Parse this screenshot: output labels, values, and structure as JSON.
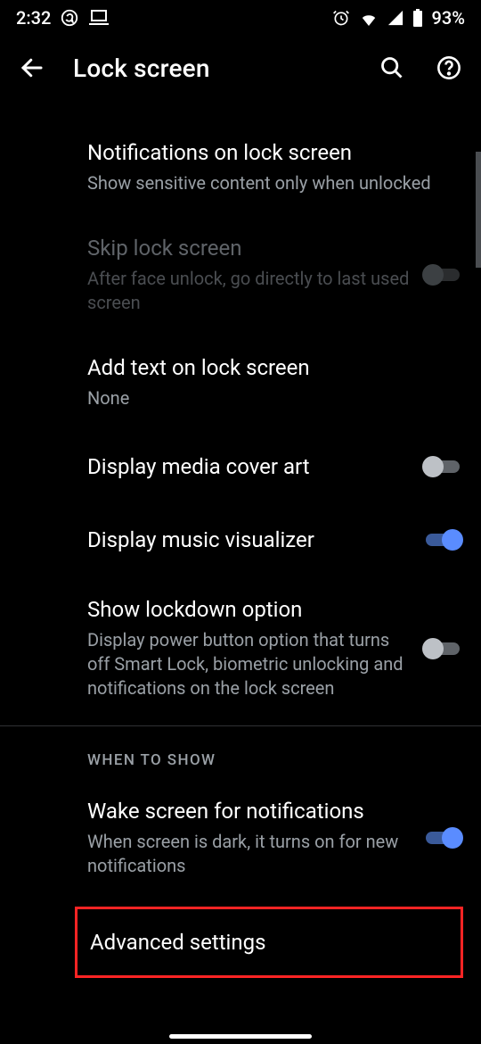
{
  "status": {
    "time": "2:32",
    "battery": "93%"
  },
  "appbar": {
    "title": "Lock screen"
  },
  "settings": [
    {
      "title": "Notifications on lock screen",
      "subtitle": "Show sensitive content only when unlocked"
    },
    {
      "title": "Skip lock screen",
      "subtitle": "After face unlock, go directly to last used screen"
    },
    {
      "title": "Add text on lock screen",
      "subtitle": "None"
    },
    {
      "title": "Display media cover art"
    },
    {
      "title": "Display music visualizer"
    },
    {
      "title": "Show lockdown option",
      "subtitle": "Display power button option that turns off Smart Lock, biometric unlocking and notifications on the lock screen"
    }
  ],
  "section_header": "WHEN TO SHOW",
  "section_settings": [
    {
      "title": "Wake screen for notifications",
      "subtitle": "When screen is dark, it turns on for new notifications"
    },
    {
      "title": "Advanced settings"
    }
  ]
}
